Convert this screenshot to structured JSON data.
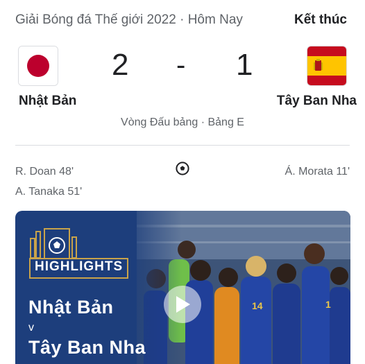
{
  "header": {
    "title": "Giải Bóng đá Thế giới 2022 · Hôm Nay",
    "status": "Kết thúc"
  },
  "home": {
    "name": "Nhật Bản",
    "score": "2",
    "flag_icon": "japan-flag-icon",
    "scorers": [
      "R. Doan 48'",
      "A. Tanaka 51'"
    ]
  },
  "away": {
    "name": "Tây Ban Nha",
    "score": "1",
    "flag_icon": "spain-flag-icon",
    "scorers": [
      "Á. Morata 11'"
    ]
  },
  "separator": "-",
  "stage": "Vòng Đấu bảng · Bảng E",
  "highlights": {
    "label": "HIGHLIGHTS",
    "home": "Nhật Bản",
    "versus": "v",
    "away": "Tây Ban Nha",
    "play_icon": "play-icon"
  },
  "colors": {
    "japan_red": "#bc002d",
    "spain_red": "#c60b1e",
    "spain_yellow": "#ffc400",
    "video_blue": "#1d3e7c",
    "gold": "#c9a34a"
  }
}
